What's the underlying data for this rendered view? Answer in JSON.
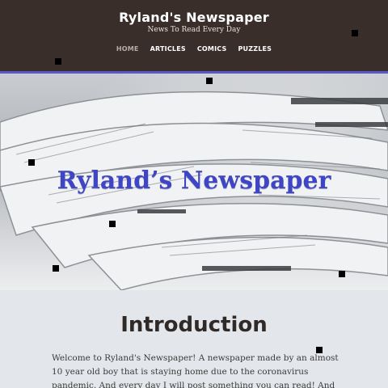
{
  "header": {
    "title": "Ryland's Newspaper",
    "tagline": "News To Read Every Day"
  },
  "nav": {
    "items": [
      {
        "label": "HOME",
        "active": true
      },
      {
        "label": "ARTICLES",
        "active": false
      },
      {
        "label": "COMICS",
        "active": false
      },
      {
        "label": "PUZZLES",
        "active": false
      }
    ]
  },
  "hero": {
    "title": "Ryland’s Newspaper"
  },
  "intro": {
    "heading": "Introduction",
    "text": "Welcome to Ryland's Newspaper! A newspaper made by an almost 10 year old boy that is staying home due to the coronavirus pandemic. And every day I will post something you can read! And if you click the menu topics, you will see all"
  },
  "colors": {
    "header_bg": "#3a2e2a",
    "accent": "#5b57c9",
    "hero_title": "#3f46c6",
    "page_bg": "#e3e6ea"
  }
}
